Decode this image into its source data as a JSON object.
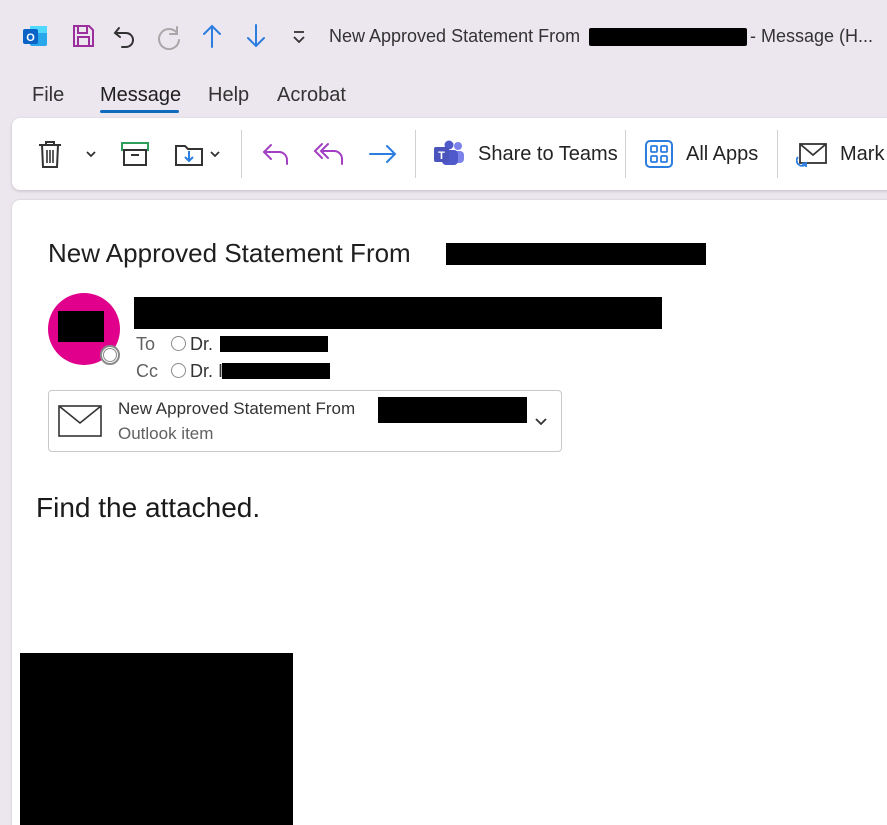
{
  "window": {
    "title": "New Approved Statement From ",
    "title_suffix": "-  Message (H..."
  },
  "quick_access": [
    {
      "name": "outlook-app-icon"
    },
    {
      "name": "save-icon"
    },
    {
      "name": "undo-icon"
    },
    {
      "name": "redo-icon"
    },
    {
      "name": "previous-item-icon"
    },
    {
      "name": "next-item-icon"
    },
    {
      "name": "customize-toolbar-icon"
    }
  ],
  "menu": {
    "tabs": [
      "File",
      "Message",
      "Help",
      "Acrobat"
    ],
    "active": "Message"
  },
  "ribbon": {
    "share_teams_label": "Share to Teams",
    "all_apps_label": "All Apps",
    "mark_label": "Mark"
  },
  "message": {
    "subject": "New Approved Statement From ",
    "to_label": "To",
    "cc_label": "Cc",
    "to_recipient_prefix": "Dr.",
    "cc_recipient_prefix": "Dr. I",
    "attachment": {
      "title": "New Approved Statement From",
      "subtitle": "Outlook item"
    },
    "body": "Find the attached."
  },
  "colors": {
    "accent": "#0f6cbd",
    "avatar": "#e0008c",
    "reply_purple": "#a23fc3",
    "forward_blue": "#2b7de0",
    "app_bg": "#ece6ef"
  }
}
